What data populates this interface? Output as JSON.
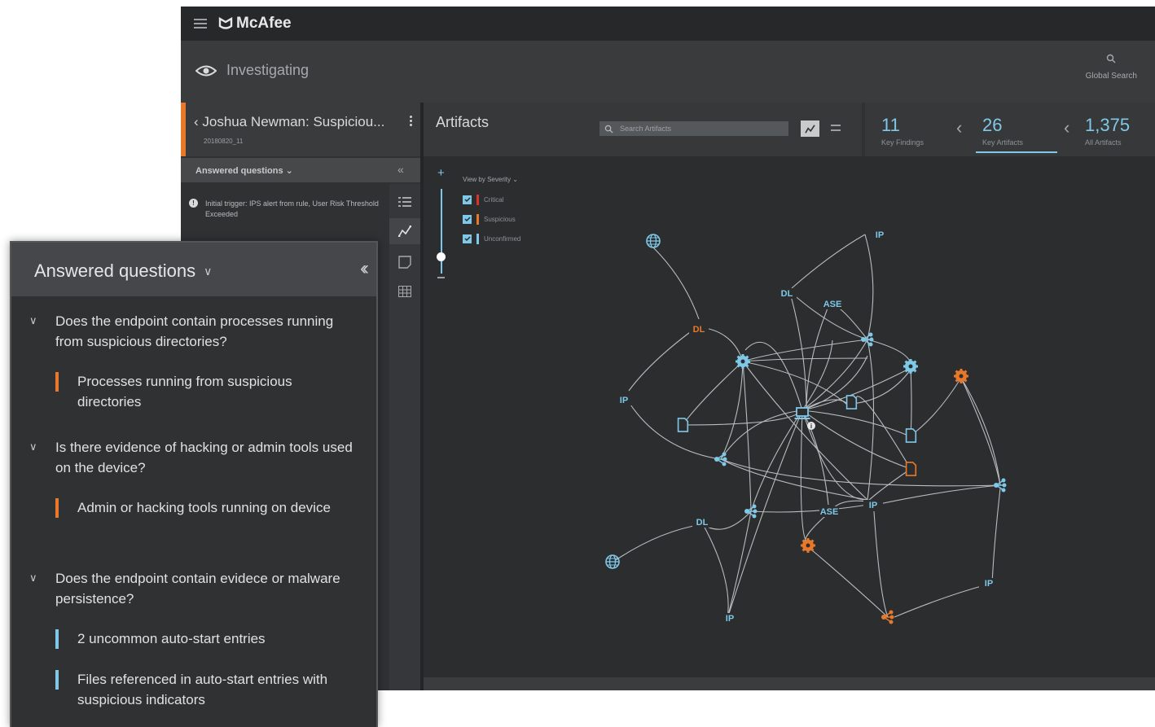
{
  "app": {
    "brand": "McAfee",
    "section": "Investigating"
  },
  "topbar": {
    "global_search": "Global Search"
  },
  "case": {
    "title": "Joshua Newman: Suspiciou...",
    "id": "20180820_11",
    "answered_label": "Answered questions",
    "trigger_text": "Initial trigger: IPS alert from rule, User Risk Threshold Exceeded"
  },
  "artifacts": {
    "title": "Artifacts",
    "search_placeholder": "Search Artifacts",
    "view_by": "View by Severity",
    "severity": [
      {
        "label": "Critical",
        "color": "#d9342b",
        "checked": true
      },
      {
        "label": "Suspicious",
        "color": "#e8782a",
        "checked": true
      },
      {
        "label": "Unconfirmed",
        "color": "#7fc8e8",
        "checked": true
      }
    ],
    "zoom_level": 0.2
  },
  "counts": [
    {
      "num": "11",
      "label": "Key Findings"
    },
    {
      "num": "26",
      "label": "Key Artifacts"
    },
    {
      "num": "1,375",
      "label": "All Artifacts"
    }
  ],
  "panel": {
    "title": "Answered questions",
    "questions": [
      {
        "q": "Does the endpoint contain processes running from suspicious directories?",
        "answers": [
          {
            "text": "Processes running from suspicious directories",
            "severity": "orange"
          }
        ]
      },
      {
        "q": "Is there evidence of hacking or admin tools used on the device?",
        "answers": [
          {
            "text": "Admin or hacking tools running on device",
            "severity": "orange"
          }
        ]
      },
      {
        "q": "Does the endpoint contain evidece or malware persistence?",
        "answers": [
          {
            "text": "2 uncommon auto-start entries",
            "severity": "blue"
          },
          {
            "text": "Files referenced in auto-start entries with suspicious indicators",
            "severity": "blue"
          }
        ]
      }
    ]
  },
  "graph": {
    "colors": {
      "blue": "#7fc8e8",
      "orange": "#e8782a",
      "edge": "#b9bcbf"
    },
    "node_labels": {
      "ip_1": "IP",
      "dl_1": "DL",
      "ase_1": "ASE",
      "dl_2": "DL",
      "ip_2": "IP",
      "ase_2": "ASE",
      "ip_3": "IP",
      "dl_3": "DL",
      "ip_4": "IP",
      "ip_5": "IP"
    }
  }
}
